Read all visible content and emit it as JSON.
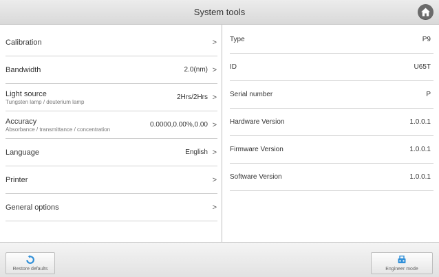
{
  "header": {
    "title": "System tools",
    "home_icon": "home-icon"
  },
  "settings": [
    {
      "label": "Calibration",
      "sub": "",
      "value": "",
      "chevron": ">"
    },
    {
      "label": "Bandwidth",
      "sub": "",
      "value": "2.0(nm)",
      "chevron": ">"
    },
    {
      "label": "Light source",
      "sub": "Tungsten lamp / deuterium lamp",
      "value": "2Hrs/2Hrs",
      "chevron": ">"
    },
    {
      "label": "Accuracy",
      "sub": "Absorbance / transmittance / concentration",
      "value": "0.0000,0.00%,0.00",
      "chevron": ">"
    },
    {
      "label": "Language",
      "sub": "",
      "value": "English",
      "chevron": ">"
    },
    {
      "label": "Printer",
      "sub": "",
      "value": "",
      "chevron": ">"
    },
    {
      "label": "General options",
      "sub": "",
      "value": "",
      "chevron": ">"
    }
  ],
  "info": [
    {
      "label": "Type",
      "value": "P9"
    },
    {
      "label": "ID",
      "value": "U65T"
    },
    {
      "label": "Serial number",
      "value": "P"
    },
    {
      "label": "Hardware Version",
      "value": "1.0.0.1"
    },
    {
      "label": "Firmware Version",
      "value": "1.0.0.1"
    },
    {
      "label": "Software Version",
      "value": "1.0.0.1"
    }
  ],
  "footer": {
    "restore_label": "Restore defaults",
    "restore_icon": "restore-icon",
    "engineer_label": "Engineer mode",
    "engineer_icon": "engineer-icon"
  },
  "colors": {
    "header_bg": "#dcdcdc",
    "home_button": "#6b6b6b",
    "restore_icon": "#2f8fd8",
    "engineer_icon": "#2f8fd8"
  }
}
